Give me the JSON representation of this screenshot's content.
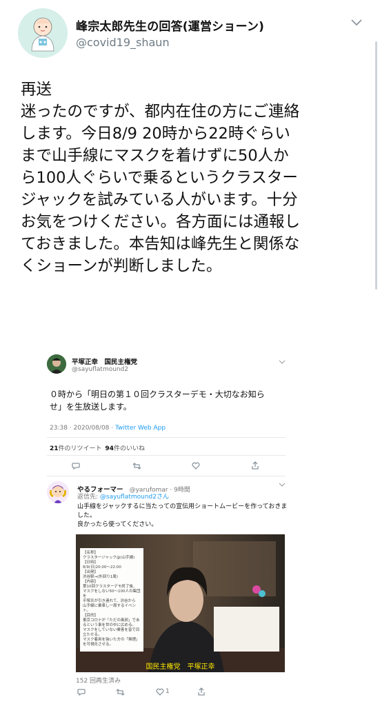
{
  "header": {
    "display_name": "峰宗太郎先生の回答(運営ショーン)",
    "handle": "@covid19_shaun"
  },
  "tweet_lines": [
    "再送",
    "迷ったのですが、都内在住の方にご連絡",
    "します。今日8/9 20時から22時ぐらい",
    "まで山手線にマスクを着けずに50人か",
    "ら100人ぐらいで乗るというクラスター",
    "ジャックを試みている人がいます。十分",
    "お気をつけください。各方面には通報し",
    "ておきました。本告知は峰先生と関係な",
    "くショーンが判断しました。"
  ],
  "embed": {
    "tweet1": {
      "name": "平塚正幸　国民主権党",
      "handle": "@sayuflatmound2",
      "text_lines": [
        "０時から「明日の第１０回クラスターデモ・大切なお知ら",
        "せ」を生放送します。"
      ],
      "time": "23:38 · 2020/08/08 · ",
      "app": "Twitter Web App",
      "retweets": "21",
      "retweets_label": "件のリツイート",
      "likes": "94",
      "likes_label": "件のいいね"
    },
    "tweet2": {
      "name": "やるフォーマー",
      "handle_time": "@yarufomar · 9時間",
      "reply_prefix": "返信先: ",
      "reply_to": "@sayuflatmound2さん",
      "text_lines": [
        "山手線をジャックするに当たっての宣伝用ショートムービーを作っておきま",
        "した。",
        "良かったら使ってください。"
      ],
      "video_memo": [
        "【名称】",
        "クラスタージャック@(山手線)",
        "【日時】",
        "8/9(日)20:00～22:00",
        "【出発】",
        "渋谷駅→(外回り1周)",
        "【内容】",
        "第10回クラスターデモ終了後、",
        "マスクをしない50～100人の集団を",
        "平塚氏が引き連れて、渋谷から",
        "山手線に乗車し一周するイベント。",
        "【目的】",
        "東京コロナが「ただの風邪」であるという事を世の中に広める。",
        "マスクをしていない乗客を皆で目立たせる。",
        "マスク着用を強いた方の「無理」を可視化させる。"
      ],
      "video_caption": "国民主権党　平塚正幸",
      "views": "152 回再生済み",
      "like_count": "1"
    }
  }
}
